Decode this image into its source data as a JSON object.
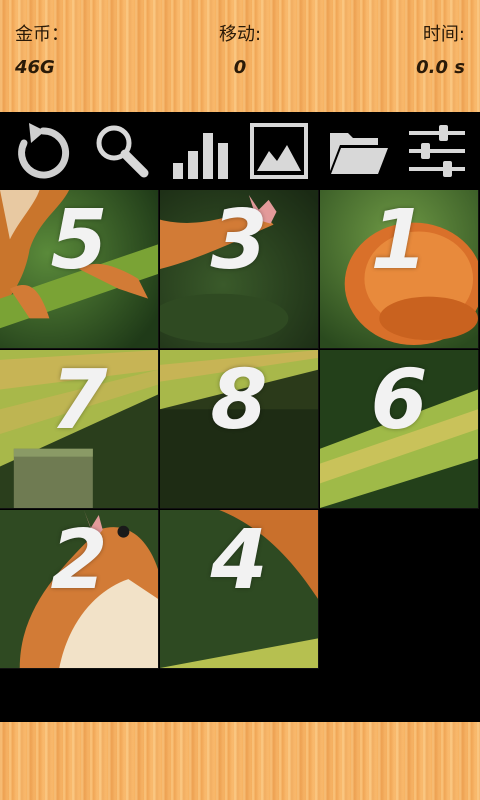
{
  "header": {
    "coins": {
      "label": "金币：",
      "value": "46G"
    },
    "moves": {
      "label": "移动:",
      "value": "0"
    },
    "time": {
      "label": "时间:",
      "value": "0.0 s"
    }
  },
  "toolbar": {
    "buttons": [
      {
        "icon": "restart-icon"
      },
      {
        "icon": "search-icon"
      },
      {
        "icon": "stats-icon"
      },
      {
        "icon": "image-icon"
      },
      {
        "icon": "folder-icon"
      },
      {
        "icon": "settings-sliders-icon"
      }
    ]
  },
  "board": {
    "grid_size": 3,
    "tiles": [
      {
        "number": "5"
      },
      {
        "number": "3"
      },
      {
        "number": "1"
      },
      {
        "number": "7"
      },
      {
        "number": "8"
      },
      {
        "number": "6"
      },
      {
        "number": "2"
      },
      {
        "number": "4"
      },
      {
        "number": ""
      }
    ]
  },
  "colors": {
    "wood": "#f7b262",
    "text_dark": "#2a1a08",
    "tile_number": "#f2f2f2"
  }
}
